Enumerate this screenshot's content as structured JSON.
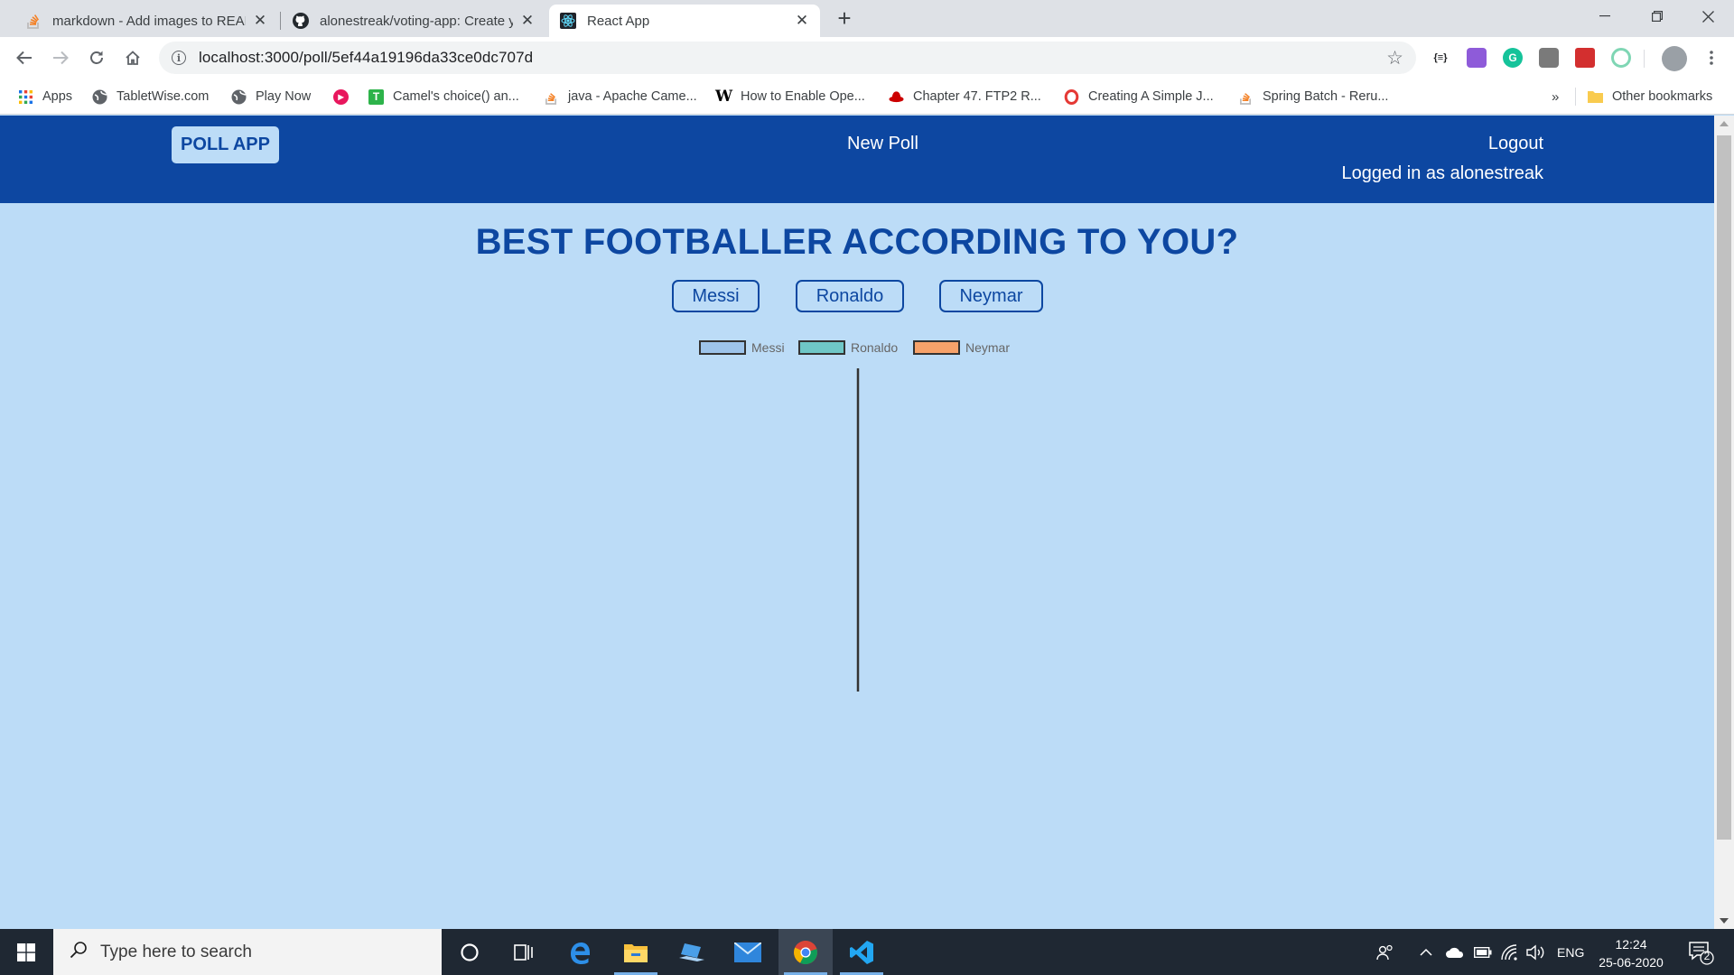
{
  "browser": {
    "tabs": [
      {
        "title": "markdown - Add images to README",
        "favicon": "stackoverflow-icon"
      },
      {
        "title": "alonestreak/voting-app: Create your own polls",
        "favicon": "github-icon"
      },
      {
        "title": "React App",
        "favicon": "react-icon",
        "active": true
      }
    ],
    "url": "localhost:3000/poll/5ef44a19196da33ce0dc707d",
    "bookmarks": [
      {
        "label": "Apps",
        "icon": "apps-grid-icon"
      },
      {
        "label": "TabletWise.com",
        "icon": "globe-icon"
      },
      {
        "label": "Play Now",
        "icon": "globe-icon"
      },
      {
        "label": "",
        "icon": "red-circle-icon"
      },
      {
        "label": "Camel's choice() an...",
        "icon": "green-t-icon"
      },
      {
        "label": "java - Apache Came...",
        "icon": "stackoverflow-icon"
      },
      {
        "label": "How to Enable Ope...",
        "icon": "wikipedia-icon"
      },
      {
        "label": "Chapter 47. FTP2 R...",
        "icon": "redhat-icon"
      },
      {
        "label": "Creating A Simple J...",
        "icon": "opera-icon"
      },
      {
        "label": "Spring Batch - Reru...",
        "icon": "stackoverflow-icon"
      }
    ],
    "bookmarks_overflow": "»",
    "other_bookmarks": "Other bookmarks"
  },
  "app": {
    "logo": "POLL APP",
    "new_poll": "New Poll",
    "logout": "Logout",
    "logged_in": "Logged in as alonestreak",
    "poll_question": "BEST FOOTBALLER ACCORDING TO YOU?",
    "options": [
      "Messi",
      "Ronaldo",
      "Neymar"
    ]
  },
  "chart_data": {
    "type": "pie",
    "categories": [
      "Messi",
      "Ronaldo",
      "Neymar"
    ],
    "values": [
      0,
      0,
      0
    ],
    "colors": [
      "#9ec4ea",
      "#6fc7c7",
      "#f7a26a"
    ],
    "legend_placement": "top",
    "title": ""
  },
  "taskbar": {
    "search_placeholder": "Type here to search",
    "language": "ENG",
    "time": "12:24",
    "date": "25-06-2020",
    "notifications": "2"
  }
}
